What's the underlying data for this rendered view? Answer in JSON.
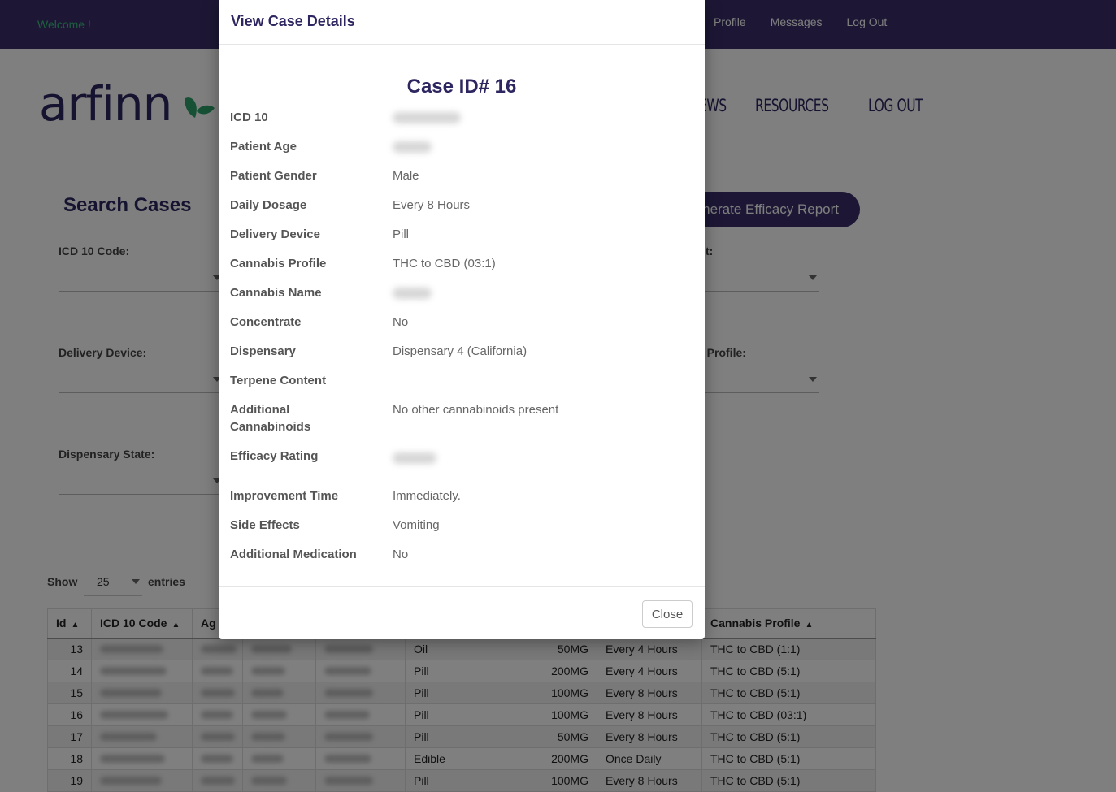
{
  "topbar": {
    "welcome": "Welcome !",
    "links": [
      "Profile",
      "Messages",
      "Log Out"
    ]
  },
  "header": {
    "logo": "arfinn",
    "nav": [
      "EWS",
      "RESOURCES",
      "LOG OUT"
    ]
  },
  "search": {
    "title": "Search Cases",
    "report_button": "enerate Efficacy Report",
    "fields": {
      "icd": "ICD 10 Code:",
      "delivery": "Delivery Device:",
      "dispensary_state": "Dispensary State:",
      "right_top": "t:",
      "right_mid": "s Profile:"
    }
  },
  "table": {
    "show_label": "Show",
    "page_size": "25",
    "entries_label": "entries",
    "headers": [
      "Id",
      "ICD 10 Code",
      "Ag",
      "Cannabis Profile"
    ],
    "rows": [
      {
        "id": "13",
        "device": "Oil",
        "dose": "50MG",
        "freq": "Every 4 Hours",
        "profile": "THC to CBD (1:1)"
      },
      {
        "id": "14",
        "device": "Pill",
        "dose": "200MG",
        "freq": "Every 4 Hours",
        "profile": "THC to CBD (5:1)"
      },
      {
        "id": "15",
        "device": "Pill",
        "dose": "100MG",
        "freq": "Every 8 Hours",
        "profile": "THC to CBD (5:1)"
      },
      {
        "id": "16",
        "device": "Pill",
        "dose": "100MG",
        "freq": "Every 8 Hours",
        "profile": "THC to CBD (03:1)"
      },
      {
        "id": "17",
        "device": "Pill",
        "dose": "50MG",
        "freq": "Every 8 Hours",
        "profile": "THC to CBD (5:1)"
      },
      {
        "id": "18",
        "device": "Edible",
        "dose": "200MG",
        "freq": "Once Daily",
        "profile": "THC to CBD (5:1)"
      },
      {
        "id": "19",
        "device": "Pill",
        "dose": "100MG",
        "freq": "Every 8 Hours",
        "profile": "THC to CBD (5:1)"
      }
    ]
  },
  "modal": {
    "title": "View Case Details",
    "case_id": "Case ID# 16",
    "close_label": "Close",
    "details": [
      {
        "label": "ICD 10",
        "value": ""
      },
      {
        "label": "Patient Age",
        "value": ""
      },
      {
        "label": "Patient Gender",
        "value": "Male"
      },
      {
        "label": "Daily Dosage",
        "value": "Every 8 Hours"
      },
      {
        "label": "Delivery Device",
        "value": "Pill"
      },
      {
        "label": "Cannabis Profile",
        "value": "THC to CBD (03:1)"
      },
      {
        "label": "Cannabis Name",
        "value": ""
      },
      {
        "label": "Concentrate",
        "value": "No"
      },
      {
        "label": "Dispensary",
        "value": "Dispensary 4 (California)"
      },
      {
        "label": "Terpene Content",
        "value": ""
      },
      {
        "label": "Additional Cannabinoids",
        "value": "No other cannabinoids present"
      },
      {
        "label": "Efficacy Rating",
        "value": ""
      },
      {
        "label": "Improvement Time",
        "value": "Immediately."
      },
      {
        "label": "Side Effects",
        "value": "Vomiting"
      },
      {
        "label": "Additional Medication",
        "value": "No"
      }
    ]
  }
}
